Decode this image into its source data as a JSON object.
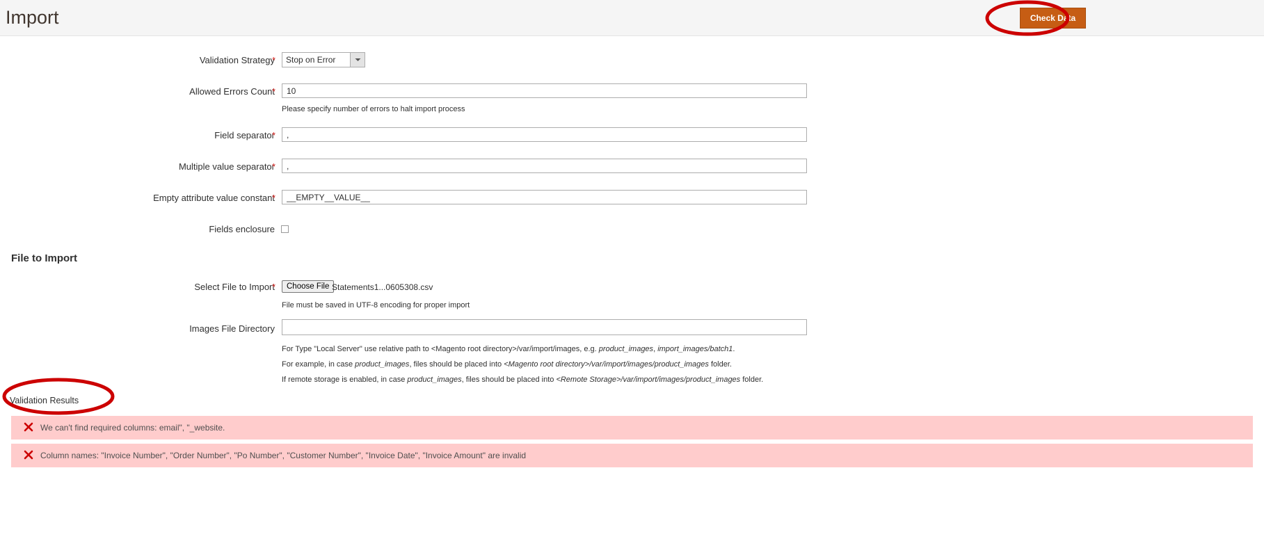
{
  "header": {
    "title": "Import",
    "check_data_label": "Check Data"
  },
  "colors": {
    "accent_button": "#c65d14",
    "annotation": "#cc0000",
    "error_background": "#ffcccc",
    "error_icon": "#cc0000",
    "required_star": "#e02b27",
    "header_background": "#f5f5f5"
  },
  "import_behavior": {
    "fields": [
      {
        "name": "validation-strategy",
        "label": "Validation Strategy",
        "required": true,
        "type": "select",
        "value": "Stop on Error"
      },
      {
        "name": "allowed-errors-count",
        "label": "Allowed Errors Count",
        "required": true,
        "type": "text",
        "value": "10",
        "note": "Please specify number of errors to halt import process"
      },
      {
        "name": "field-separator",
        "label": "Field separator",
        "required": true,
        "type": "text",
        "value": ","
      },
      {
        "name": "multiple-value-separator",
        "label": "Multiple value separator",
        "required": true,
        "type": "text",
        "value": ","
      },
      {
        "name": "empty-attribute-value-constant",
        "label": "Empty attribute value constant",
        "required": true,
        "type": "text",
        "value": "__EMPTY__VALUE__"
      },
      {
        "name": "fields-enclosure",
        "label": "Fields enclosure",
        "required": false,
        "type": "checkbox",
        "checked": false
      }
    ]
  },
  "file_to_import": {
    "section_title": "File to Import",
    "select_file": {
      "label": "Select File to Import",
      "required": true,
      "button_label": "Choose File",
      "file_name": "Statements1...0605308.csv",
      "note": "File must be saved in UTF-8 encoding for proper import"
    },
    "images_file_directory": {
      "label": "Images File Directory",
      "required": false,
      "value": "",
      "notes": [
        {
          "parts": [
            {
              "text": "For Type \"Local Server\" use relative path to <Magento root directory>/var/import/images, e.g. ",
              "italic": false
            },
            {
              "text": "product_images",
              "italic": true
            },
            {
              "text": ", ",
              "italic": false
            },
            {
              "text": "import_images/batch1",
              "italic": true
            },
            {
              "text": ".",
              "italic": false
            }
          ]
        },
        {
          "parts": [
            {
              "text": "For example, in case ",
              "italic": false
            },
            {
              "text": "product_images",
              "italic": true
            },
            {
              "text": ", files should be placed into ",
              "italic": false
            },
            {
              "text": "<Magento root directory>/var/import/images/product_images",
              "italic": true
            },
            {
              "text": " folder.",
              "italic": false
            }
          ]
        },
        {
          "parts": [
            {
              "text": "If remote storage is enabled, in case ",
              "italic": false
            },
            {
              "text": "product_images",
              "italic": true
            },
            {
              "text": ", files should be placed into ",
              "italic": false
            },
            {
              "text": "<Remote Storage>/var/import/images/product_images",
              "italic": true
            },
            {
              "text": " folder.",
              "italic": false
            }
          ]
        }
      ]
    }
  },
  "validation_results": {
    "title": "Validation Results",
    "errors": [
      {
        "icon": "error-x-icon",
        "text": "We can't find required columns: email\", \"_website."
      },
      {
        "icon": "error-x-icon",
        "text": "Column names: \"Invoice Number\", \"Order Number\", \"Po Number\", \"Customer Number\", \"Invoice Date\", \"Invoice Amount\" are invalid"
      }
    ]
  }
}
